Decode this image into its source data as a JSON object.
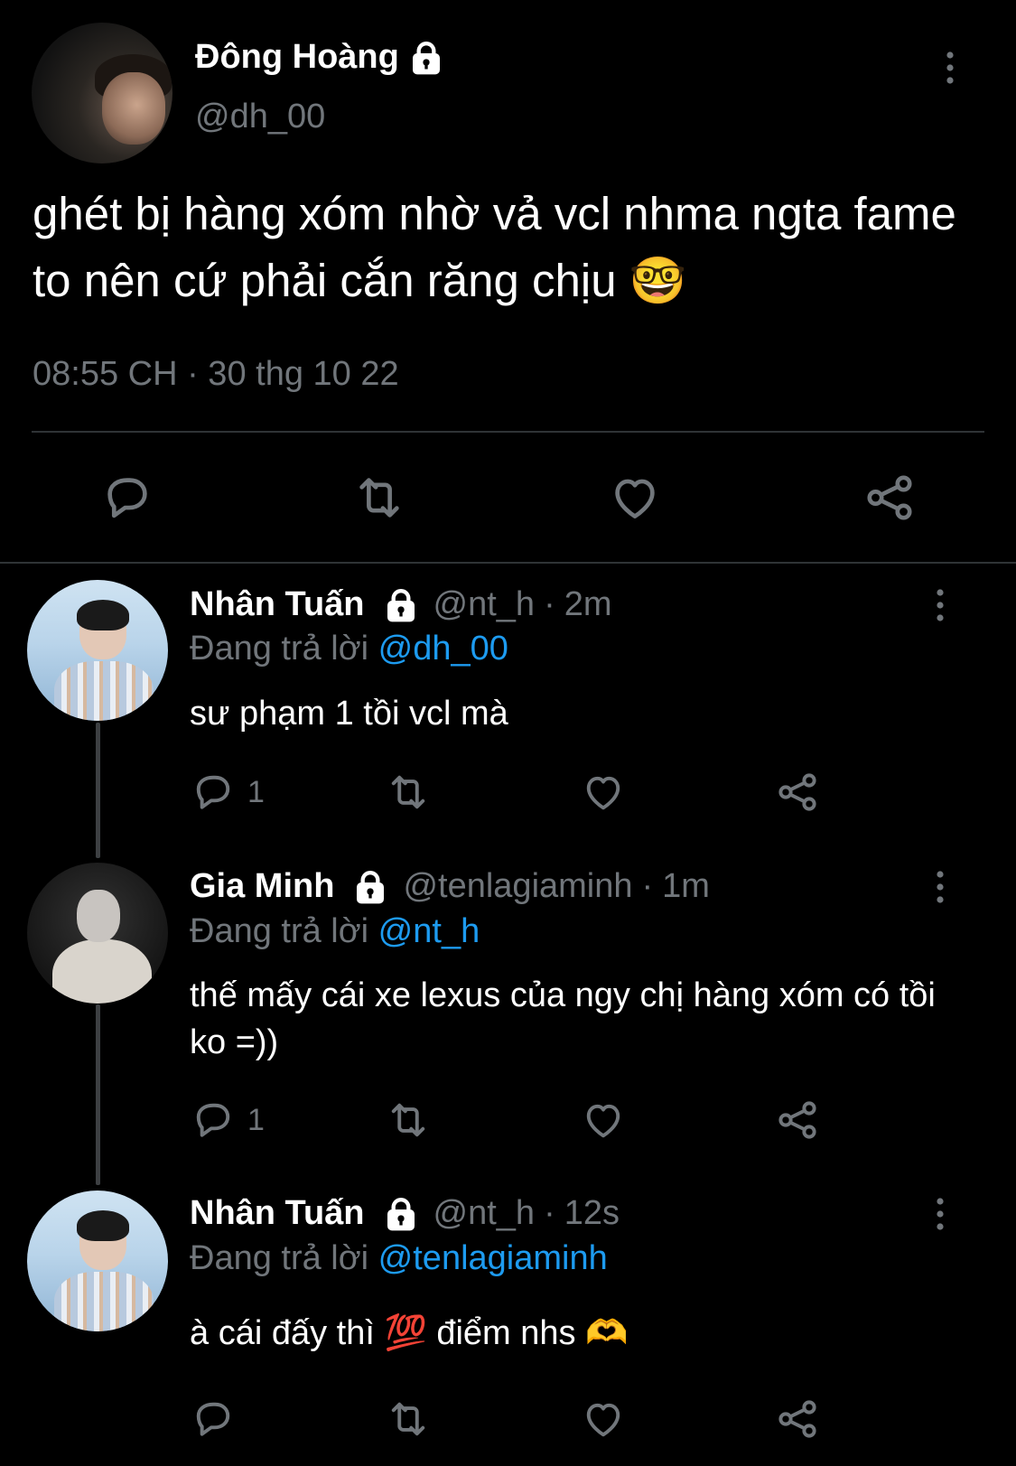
{
  "main": {
    "name": "Đông Hoàng",
    "handle": "@dh_00",
    "text": "ghét bị hàng xóm nhờ vả vcl nhma ngta fame to nên cứ phải cắn răng chịu 🤓",
    "time": "08:55 CH · 30 thg 10 22"
  },
  "replies": [
    {
      "name": "Nhân Tuấn",
      "handle": "@nt_h",
      "dot": "·",
      "time": "2m",
      "replying_prefix": "Đang trả lời",
      "replying_to": "@dh_00",
      "text": "sư phạm 1 tồi vcl mà",
      "reply_count": "1"
    },
    {
      "name": "Gia Minh",
      "handle": "@tenlagiaminh",
      "dot": "·",
      "time": "1m",
      "replying_prefix": "Đang trả lời",
      "replying_to": "@nt_h",
      "text": "thế mấy cái xe lexus của ngy chị hàng xóm có tồi ko =))",
      "reply_count": "1"
    },
    {
      "name": "Nhân Tuấn",
      "handle": "@nt_h",
      "dot": "·",
      "time": "12s",
      "replying_prefix": "Đang trả lời",
      "replying_to": "@tenlagiaminh",
      "text": "à cái đấy thì 💯  điểm nhs 🫶",
      "reply_count": ""
    }
  ],
  "colors": {
    "background": "#000000",
    "text": "#ffffff",
    "muted": "#71767b",
    "link": "#1d9bf0",
    "divider": "#2f3336"
  },
  "icons": [
    "lock-icon",
    "more-icon",
    "reply-icon",
    "retweet-icon",
    "like-icon",
    "share-icon"
  ]
}
